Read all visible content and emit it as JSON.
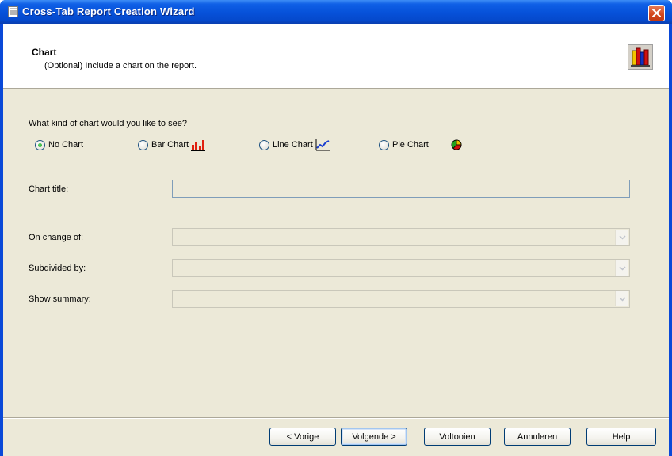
{
  "window": {
    "title": "Cross-Tab Report Creation Wizard"
  },
  "header": {
    "title": "Chart",
    "subtitle": "(Optional) Include a chart on the report."
  },
  "question": "What kind of chart would you like to see?",
  "chart_types": [
    {
      "label": "No Chart",
      "selected": true
    },
    {
      "label": "Bar Chart",
      "selected": false,
      "icon": "bar-chart-icon"
    },
    {
      "label": "Line Chart",
      "selected": false,
      "icon": "line-chart-icon"
    },
    {
      "label": "Pie Chart",
      "selected": false,
      "icon": "pie-chart-icon"
    }
  ],
  "fields": {
    "chart_title": {
      "label": "Chart title:",
      "value": ""
    },
    "on_change_of": {
      "label": "On change of:",
      "value": ""
    },
    "subdivided_by": {
      "label": "Subdivided by:",
      "value": ""
    },
    "show_summary": {
      "label": "Show summary:",
      "value": ""
    }
  },
  "buttons": {
    "back": "< Vorige",
    "next": "Volgende >",
    "finish": "Voltooien",
    "cancel": "Annuleren",
    "help": "Help"
  },
  "colors": {
    "titlebar": "#0651d9",
    "dialog_bg": "#ece9d8",
    "close_button": "#d3471e"
  }
}
